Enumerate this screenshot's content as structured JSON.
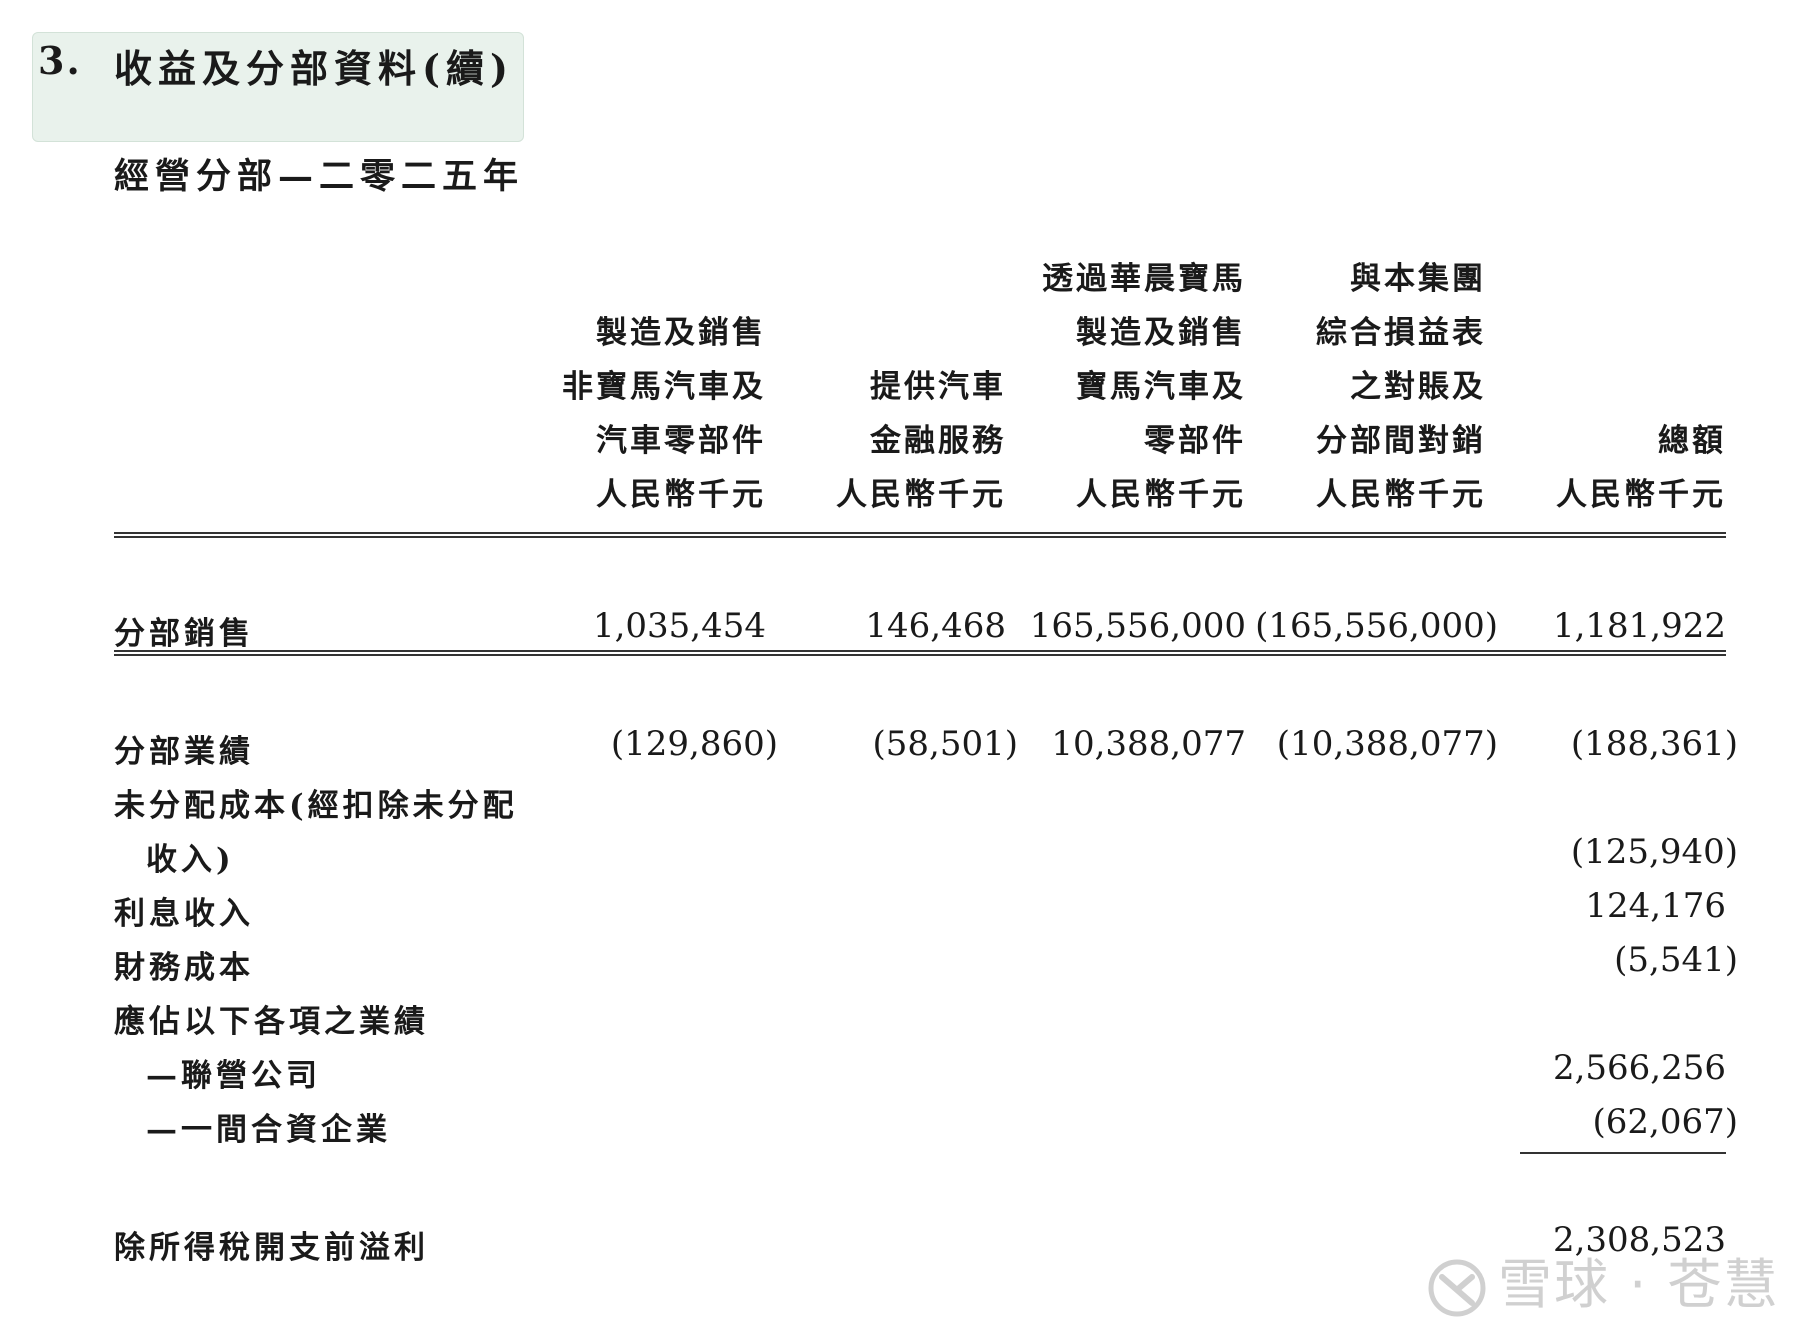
{
  "section": {
    "number": "3.",
    "title": "收益及分部資料(續)"
  },
  "subtitle": "經營分部—二零二五年",
  "columns": [
    {
      "lines": [
        "製造及銷售",
        "非寶馬汽車及",
        "汽車零部件",
        "人民幣千元"
      ]
    },
    {
      "lines": [
        "提供汽車",
        "金融服務",
        "人民幣千元"
      ]
    },
    {
      "lines": [
        "透過華晨寶馬",
        "製造及銷售",
        "寶馬汽車及",
        "零部件",
        "人民幣千元"
      ]
    },
    {
      "lines": [
        "與本集團",
        "綜合損益表",
        "之對賬及",
        "分部間對銷",
        "人民幣千元"
      ]
    },
    {
      "lines": [
        "總額",
        "人民幣千元"
      ]
    }
  ],
  "rows": {
    "segment_sales": {
      "label": "分部銷售",
      "values": [
        "1,035,454",
        "146,468",
        "165,556,000",
        "(165,556,000)",
        "1,181,922"
      ]
    },
    "segment_results": {
      "label": "分部業績",
      "values": [
        "(129,860)",
        "(58,501)",
        "10,388,077",
        "(10,388,077)",
        "(188,361)"
      ]
    },
    "unallocated": {
      "label_line1": "未分配成本(經扣除未分配",
      "label_line2": "收入)",
      "total": "(125,940)"
    },
    "interest_income": {
      "label": "利息收入",
      "total": "124,176"
    },
    "finance_costs": {
      "label": "財務成本",
      "total": "(5,541)"
    },
    "share_results": {
      "label": "應佔以下各項之業績"
    },
    "associates": {
      "label": "—聯營公司",
      "total": "2,566,256"
    },
    "joint_venture": {
      "label": "—一間合資企業",
      "total": "(62,067)"
    },
    "profit_before_tax": {
      "label": "除所得稅開支前溢利",
      "total": "2,308,523"
    }
  },
  "watermark": {
    "text": "雪球 · 苍慧",
    "icon": "xueqiu-logo-icon"
  }
}
